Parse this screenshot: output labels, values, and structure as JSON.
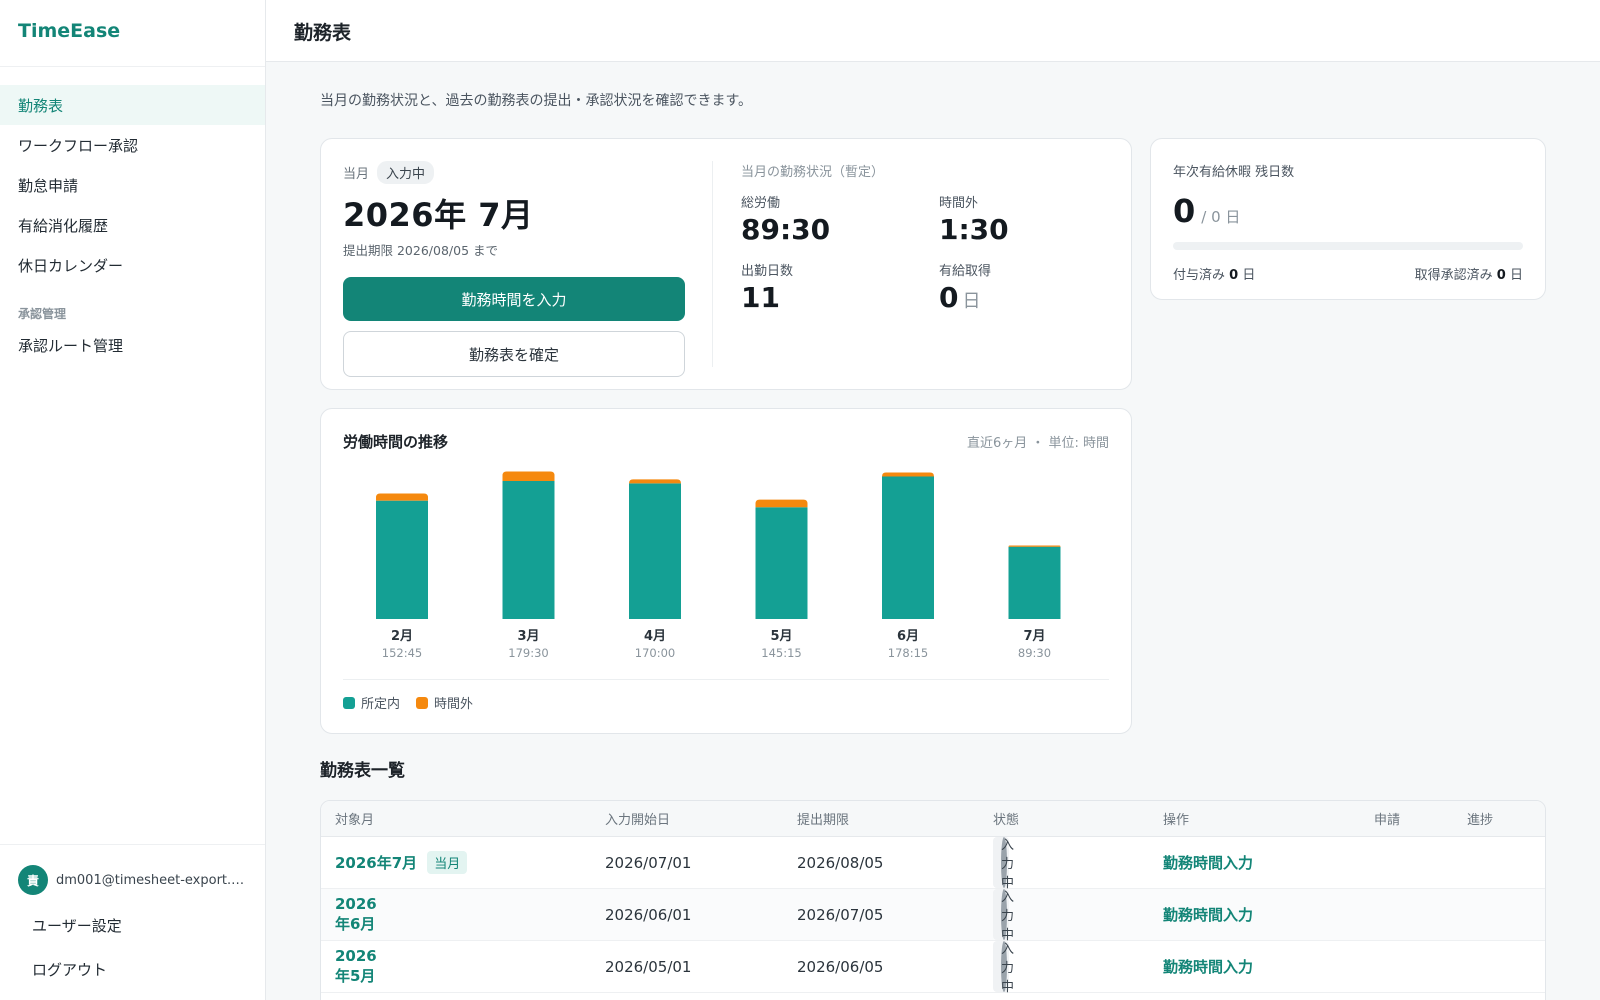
{
  "app": {
    "brand": "TimeEase"
  },
  "sidebar": {
    "items": [
      {
        "label": "勤務表",
        "active": true
      },
      {
        "label": "ワークフロー承認"
      },
      {
        "label": "勤怠申請"
      },
      {
        "label": "有給消化履歴"
      },
      {
        "label": "休日カレンダー"
      }
    ],
    "section_label": "承認管理",
    "section_items": [
      {
        "label": "承認ルート管理"
      }
    ],
    "user": {
      "avatar_char": "責",
      "email": "dm001@timesheet-export.e..."
    },
    "user_settings": "ユーザー設定",
    "logout": "ログアウト"
  },
  "header": {
    "title": "勤務表"
  },
  "intro": "当月の勤務状況と、過去の勤務表の提出・承認状況を確認できます。",
  "current_month": {
    "label": "当月",
    "status_pill": "入力中",
    "month": "2026年 7月",
    "deadline": "提出期限 2026/08/05 まで",
    "primary_button": "勤務時間を入力",
    "secondary_button": "勤務表を確定",
    "stats_title": "当月の勤務状況（暫定）",
    "stats": {
      "total_label": "総労働",
      "total_value": "89:30",
      "overtime_label": "時間外",
      "overtime_value": "1:30",
      "days_label": "出勤日数",
      "days_value": "11",
      "paid_label": "有給取得",
      "paid_value": "0",
      "paid_unit": "日"
    }
  },
  "leave": {
    "title": "年次有給休暇 残日数",
    "remaining": "0",
    "total": "/ 0 日",
    "progress": 0,
    "granted_label": "付与済み",
    "granted_value": "0",
    "granted_unit": "日",
    "approved_label": "取得承認済み",
    "approved_value": "0",
    "approved_unit": "日"
  },
  "chart": {
    "title": "労働時間の推移",
    "note": "直近6ヶ月 ・ 単位: 時間",
    "legend": [
      {
        "label": "所定内",
        "color": "#14a094"
      },
      {
        "label": "時間外",
        "color": "#f5890f"
      }
    ]
  },
  "chart_data": {
    "type": "bar",
    "stacked": true,
    "categories": [
      "2月",
      "3月",
      "4月",
      "5月",
      "6月",
      "7月"
    ],
    "totals": [
      "152:45",
      "179:30",
      "170:00",
      "145:15",
      "178:15",
      "89:30"
    ],
    "series": [
      {
        "name": "所定内",
        "color": "#14a094",
        "values": [
          144.0,
          168.0,
          165.0,
          136.0,
          173.5,
          88.0
        ]
      },
      {
        "name": "時間外",
        "color": "#f5890f",
        "values": [
          8.75,
          11.5,
          5.0,
          9.25,
          4.75,
          1.5
        ]
      }
    ],
    "ylim": [
      0,
      185
    ]
  },
  "list": {
    "title": "勤務表一覧",
    "headers": [
      "対象月",
      "入力開始日",
      "提出期限",
      "状態",
      "操作",
      "申請",
      "進捗"
    ],
    "rows": [
      {
        "month": "2026年7月",
        "badge": "当月",
        "start": "2026/07/01",
        "deadline": "2026/08/05",
        "status": "入力中",
        "action": "勤務時間入力"
      },
      {
        "month": "2026年6月",
        "badge": "",
        "start": "2026/06/01",
        "deadline": "2026/07/05",
        "status": "入力中",
        "action": "勤務時間入力"
      },
      {
        "month": "2026年5月",
        "badge": "",
        "start": "2026/05/01",
        "deadline": "2026/06/05",
        "status": "入力中",
        "action": "勤務時間入力"
      }
    ]
  }
}
